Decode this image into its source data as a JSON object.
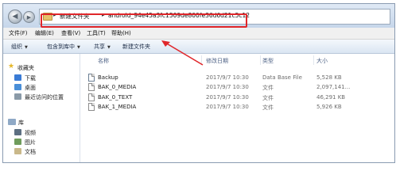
{
  "address": {
    "crumbs": [
      "新建文件夹",
      "android_94e45a3fc1509de800fe36d6d21c5c12"
    ],
    "separator": "▸"
  },
  "menu": [
    "文件(F)",
    "编辑(E)",
    "查看(V)",
    "工具(T)",
    "帮助(H)"
  ],
  "toolbar": {
    "organize": "组织",
    "include_library": "包含到库中",
    "share": "共享",
    "new_folder": "新建文件夹"
  },
  "nav": {
    "favorites": "收藏夹",
    "downloads": "下载",
    "desktop": "桌面",
    "recent": "最近访问的位置",
    "libraries": "库",
    "videos": "视频",
    "pictures": "图片",
    "documents": "文档"
  },
  "columns": {
    "name": "名称",
    "modified": "修改日期",
    "type": "类型",
    "size": "大小"
  },
  "files": [
    {
      "name": "Backup",
      "modified": "2017/9/7 10:30",
      "type": "Data Base File",
      "size": "5,528 KB"
    },
    {
      "name": "BAK_0_MEDIA",
      "modified": "2017/9/7 10:30",
      "type": "文件",
      "size": "2,097,141..."
    },
    {
      "name": "BAK_0_TEXT",
      "modified": "2017/9/7 10:30",
      "type": "文件",
      "size": "46,291 KB"
    },
    {
      "name": "BAK_1_MEDIA",
      "modified": "2017/9/7 10:30",
      "type": "文件",
      "size": "5,926 KB"
    }
  ],
  "colors": {
    "highlight": "#e0262a",
    "folder": "#e6c26b"
  }
}
